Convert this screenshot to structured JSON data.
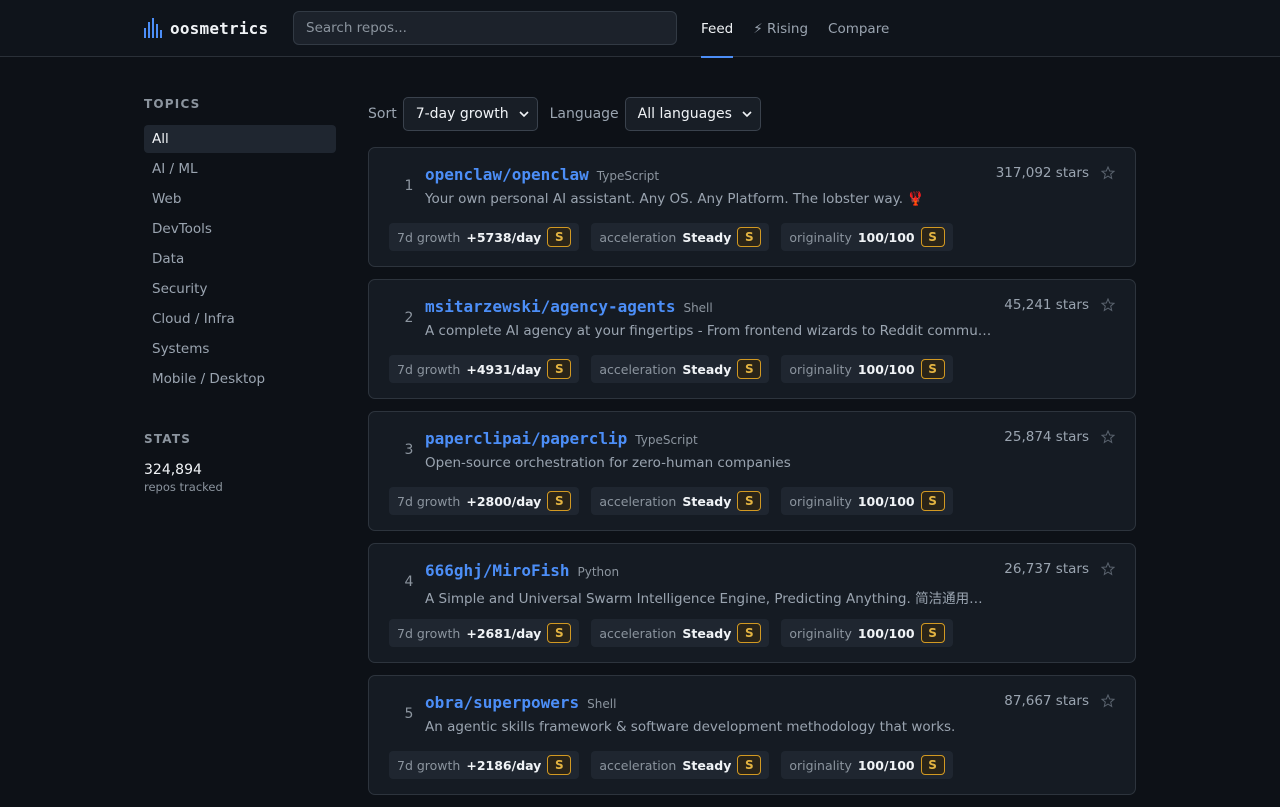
{
  "header": {
    "logo_text": "oosmetrics",
    "search_placeholder": "Search repos...",
    "tabs": [
      {
        "label": "Feed",
        "active": true
      },
      {
        "label": "⚡ Rising",
        "active": false
      },
      {
        "label": "Compare",
        "active": false
      }
    ]
  },
  "sidebar": {
    "topics_heading": "TOPICS",
    "topics": [
      "All",
      "AI / ML",
      "Web",
      "DevTools",
      "Data",
      "Security",
      "Cloud / Infra",
      "Systems",
      "Mobile / Desktop"
    ],
    "stats_heading": "STATS",
    "stats_value": "324,894",
    "stats_label": "repos tracked"
  },
  "filters": {
    "sort_label": "Sort",
    "sort_value": "7-day growth",
    "language_label": "Language",
    "language_value": "All languages"
  },
  "metric_labels": {
    "growth": "7d growth",
    "acceleration": "acceleration",
    "originality": "originality"
  },
  "repos": [
    {
      "rank": "1",
      "name": "openclaw/openclaw",
      "language": "TypeScript",
      "stars": "317,092 stars",
      "description": "Your own personal AI assistant. Any OS. Any Platform. The lobster way. 🦞",
      "growth": "+5738/day",
      "growth_grade": "S",
      "acceleration": "Steady",
      "acceleration_grade": "S",
      "originality": "100/100",
      "originality_grade": "S"
    },
    {
      "rank": "2",
      "name": "msitarzewski/agency-agents",
      "language": "Shell",
      "stars": "45,241 stars",
      "description": "A complete AI agency at your fingertips - From frontend wizards to Reddit community ...",
      "growth": "+4931/day",
      "growth_grade": "S",
      "acceleration": "Steady",
      "acceleration_grade": "S",
      "originality": "100/100",
      "originality_grade": "S"
    },
    {
      "rank": "3",
      "name": "paperclipai/paperclip",
      "language": "TypeScript",
      "stars": "25,874 stars",
      "description": "Open-source orchestration for zero-human companies",
      "growth": "+2800/day",
      "growth_grade": "S",
      "acceleration": "Steady",
      "acceleration_grade": "S",
      "originality": "100/100",
      "originality_grade": "S"
    },
    {
      "rank": "4",
      "name": "666ghj/MiroFish",
      "language": "Python",
      "stars": "26,737 stars",
      "description": "A Simple and Universal Swarm Intelligence Engine, Predicting Anything. 简洁通用的群体...",
      "growth": "+2681/day",
      "growth_grade": "S",
      "acceleration": "Steady",
      "acceleration_grade": "S",
      "originality": "100/100",
      "originality_grade": "S"
    },
    {
      "rank": "5",
      "name": "obra/superpowers",
      "language": "Shell",
      "stars": "87,667 stars",
      "description": "An agentic skills framework & software development methodology that works.",
      "growth": "+2186/day",
      "growth_grade": "S",
      "acceleration": "Steady",
      "acceleration_grade": "S",
      "originality": "100/100",
      "originality_grade": "S"
    }
  ]
}
